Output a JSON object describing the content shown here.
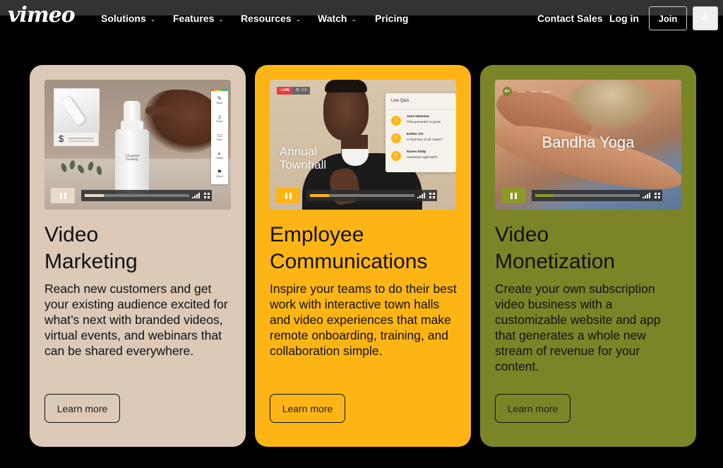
{
  "nav": {
    "logo": "vimeo",
    "items": [
      {
        "label": "Solutions",
        "has_dropdown": true
      },
      {
        "label": "Features",
        "has_dropdown": true
      },
      {
        "label": "Resources",
        "has_dropdown": true
      },
      {
        "label": "Watch",
        "has_dropdown": true
      },
      {
        "label": "Pricing",
        "has_dropdown": false
      }
    ],
    "chevron": "⌄",
    "contact_sales": "Contact Sales",
    "log_in": "Log in",
    "join": "Join",
    "plus": "+"
  },
  "cards": [
    {
      "title_line1": "Video",
      "title_line2": "Marketing",
      "description": "Reach new customers and get your existing audience excited for what’s next with branded videos, virtual events, and webinars that can be shared everywhere.",
      "button": "Learn more",
      "color": "#dcc9b7",
      "media": {
        "thumb_price_symbol": "$",
        "bottle_label": "Chapter Twenty",
        "toolbar": [
          {
            "icon": "✎",
            "label": "Styles"
          },
          {
            "icon": "♫",
            "label": "Music"
          },
          {
            "icon": "▭",
            "label": "Ratio"
          },
          {
            "icon": "◐",
            "label": "Palette"
          },
          {
            "icon": "⚑",
            "label": "Brand"
          }
        ],
        "progress": 0.18,
        "accent": "#e8d9c8"
      }
    },
    {
      "title_line1": "Employee",
      "title_line2": "Communications",
      "description": "Inspire your teams to do their best work with interactive town halls and video experiences that make remote onboarding, training, and collaboration simple.",
      "button": "Learn more",
      "color": "#fdb515",
      "media": {
        "live_label": "• LIVE",
        "viewers": "👁 12K",
        "overlay_title_line1": "Annual",
        "overlay_title_line2": "Townhall",
        "qa_title": "Live Q&A",
        "qa": [
          {
            "initial": "J",
            "name": "Jose Newman",
            "message": "This presenter is great."
          },
          {
            "initial": "E",
            "name": "Esther Xie",
            "message": "Is that true of all cases?"
          },
          {
            "initial": "R",
            "name": "Raven Eddy",
            "message": "Awesome approach!"
          }
        ],
        "progress": 0.18,
        "accent": "#fdb515"
      }
    },
    {
      "title_line1": "Video",
      "title_line2": "Monetization",
      "description": "Create your own subscription video business with a customizable website and app that generates a whole new stream of revenue for your content.",
      "button": "Learn more",
      "color": "#7c8428",
      "media": {
        "brand_initials": "BY",
        "site_nav": [
          "Classes",
          "About",
          "Search"
        ],
        "overlay_title": "Bandha Yoga",
        "progress": 0.17,
        "accent": "#8d9a2a"
      }
    }
  ]
}
